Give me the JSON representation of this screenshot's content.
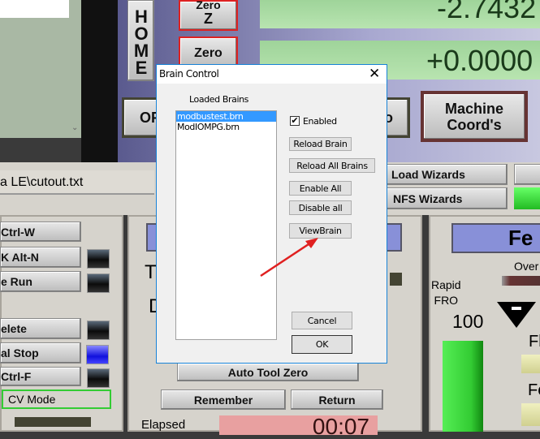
{
  "mach": {
    "home_label": "HOME",
    "zero_z_label": [
      "Zero",
      "Z"
    ],
    "zero_label": "Zero",
    "dro_z": "-2.7432",
    "dro_4": "+0.0000",
    "off_label": "OF",
    "partial_label": "o",
    "machine_coords_label": [
      "Machine",
      "Coord's"
    ],
    "file_path": "a LE\\cutout.txt",
    "load_wizards": "Load Wizards",
    "nfs_wizards": "NFS Wizards",
    "left_buttons": [
      "Ctrl-W",
      "K Alt-N",
      "e Run",
      "elete",
      "al Stop",
      "Ctrl-F"
    ],
    "cv_mode": "CV Mode",
    "tool_t": "T",
    "tool_d": "D",
    "auto_tool_zero": "Auto Tool Zero",
    "remember": "Remember",
    "return": "Return",
    "elapsed_label": "Elapsed",
    "elapsed_value": "00:07",
    "feed_header": "Fe",
    "over_label": "Over",
    "rapid_fro": [
      "Rapid",
      "FRO"
    ],
    "rapid_value": "100",
    "fl_label": "Fl",
    "fe_label": "Fe"
  },
  "dialog": {
    "title": "Brain Control",
    "loaded_label": "Loaded Brains",
    "brains": [
      "modbustest.brn",
      "ModIOMPG.brn"
    ],
    "selected": 0,
    "enabled_label": "Enabled",
    "enabled_checked": true,
    "buttons": {
      "reload_brain": "Reload Brain",
      "reload_all": "Reload All Brains",
      "enable_all": "Enable All",
      "disable_all": "Disable all",
      "view_brain": "ViewBrain",
      "cancel": "Cancel",
      "ok": "OK"
    }
  },
  "colors": {
    "accent_select": "#3399ff",
    "annotation_arrow": "#e02020",
    "dro_green": "#a8d8a0"
  }
}
